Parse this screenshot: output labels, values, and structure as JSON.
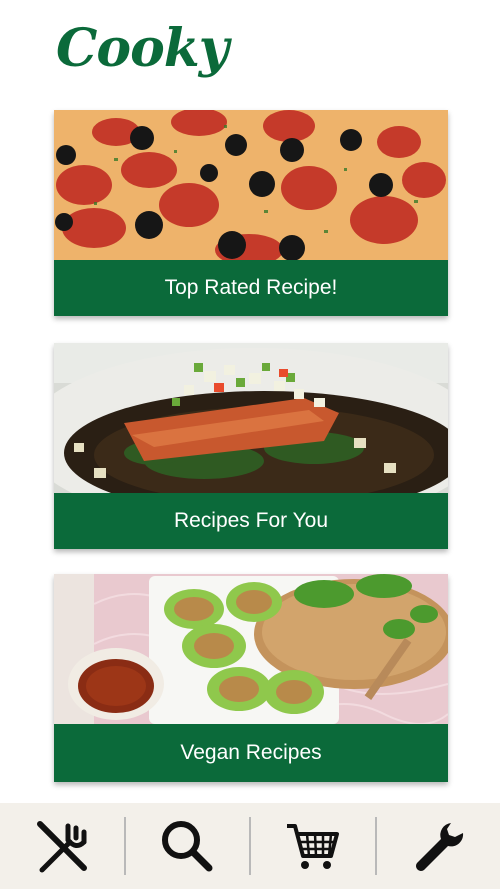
{
  "app": {
    "logo_text": "Cooky",
    "brand_color": "#0b6a3a"
  },
  "cards": [
    {
      "label": "Top Rated Recipe!",
      "image": "pepperoni-olive-pizza-photo"
    },
    {
      "label": "Recipes For You",
      "image": "salmon-salsa-plate-photo"
    },
    {
      "label": "Vegan Recipes",
      "image": "lettuce-wraps-photo"
    }
  ],
  "nav": {
    "items": [
      {
        "icon": "fork-knife-icon"
      },
      {
        "icon": "search-icon"
      },
      {
        "icon": "cart-icon"
      },
      {
        "icon": "wrench-icon"
      }
    ]
  }
}
